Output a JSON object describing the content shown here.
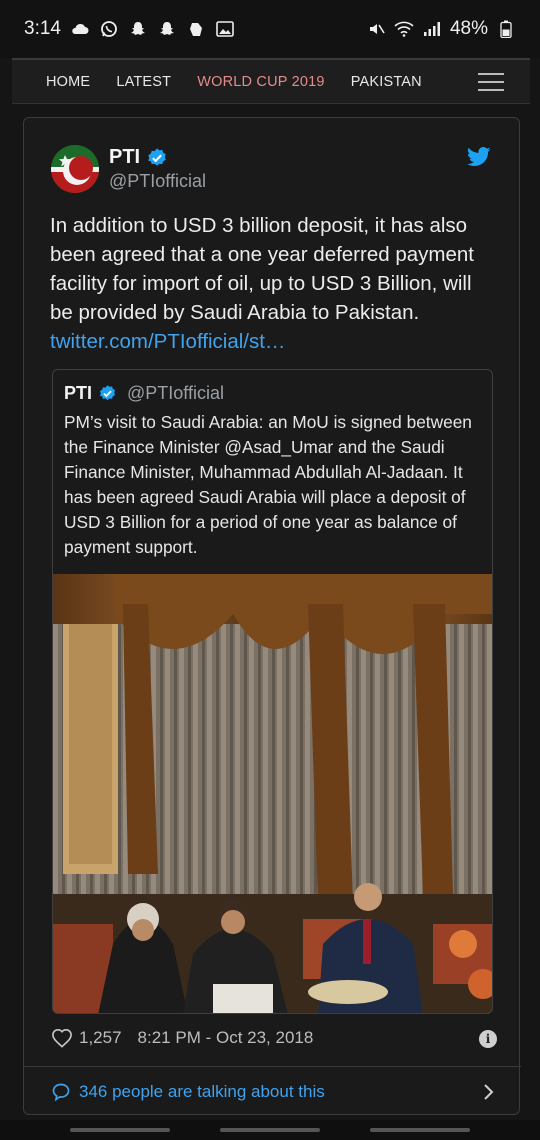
{
  "status_bar": {
    "time": "3:14",
    "battery": "48%"
  },
  "nav": {
    "items": [
      {
        "label": "HOME",
        "active": false
      },
      {
        "label": "LATEST",
        "active": false
      },
      {
        "label": "WORLD CUP 2019",
        "active": true
      },
      {
        "label": "PAKISTAN",
        "active": false
      }
    ]
  },
  "tweet": {
    "author_name": "PTI",
    "handle": "@PTIofficial",
    "text": "In addition to USD 3 billion deposit,  it has also been agreed that a one year deferred payment facility for import of oil, up to USD 3 Billion, will be provided by Saudi Arabia to Pakistan.",
    "link": "twitter.com/PTIofficial/st…",
    "likes": "1,257",
    "timestamp": "8:21 PM - Oct 23, 2018",
    "talking": "346 people are talking about this"
  },
  "quoted_tweet": {
    "author_name": "PTI",
    "handle": "@PTIofficial",
    "text": "PM’s visit to Saudi Arabia: an MoU is signed between the Finance Minister @Asad_Umar and the Saudi Finance Minister, Muhammad Abdullah Al-Jadaan. It has been agreed Saudi Arabia will place a deposit of USD 3 Billion for a period of one year as balance of payment support."
  },
  "colors": {
    "link": "#3fa3ee",
    "verified": "#1da1f2",
    "nav_active": "#e58a8a"
  },
  "icons": [
    "cloud-icon",
    "whatsapp-icon",
    "snapchat-icon",
    "snapchat-icon",
    "game-icon",
    "image-icon",
    "mute-icon",
    "wifi-icon",
    "signal-icon",
    "battery-icon",
    "verified-icon",
    "twitter-bird-icon",
    "heart-icon",
    "info-icon",
    "speech-bubble-icon",
    "chevron-right-icon",
    "menu-icon"
  ]
}
